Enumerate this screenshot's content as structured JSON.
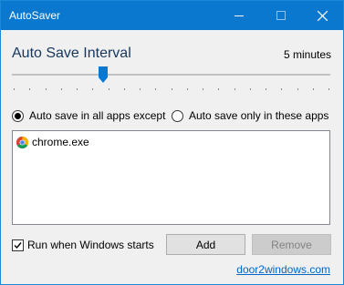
{
  "window": {
    "title": "AutoSaver",
    "controls": {
      "minimize": "minimize-icon",
      "maximize": "maximize-icon",
      "close": "close-icon"
    }
  },
  "interval": {
    "title": "Auto Save Interval",
    "value_label": "5 minutes",
    "slider_position_fraction": 0.28,
    "tick_count": 21
  },
  "mode": {
    "options": [
      {
        "label": "Auto save in all apps except",
        "selected": true
      },
      {
        "label": "Auto save only in these apps",
        "selected": false
      }
    ]
  },
  "apps": {
    "items": [
      {
        "label": "chrome.exe",
        "icon": "chrome-icon"
      }
    ]
  },
  "startup": {
    "label": "Run when Windows starts",
    "checked": true
  },
  "buttons": {
    "add": "Add",
    "remove": "Remove",
    "remove_enabled": false
  },
  "footer": {
    "link": "door2windows.com"
  },
  "colors": {
    "titlebar": "#0b78d0",
    "accent": "#0b78d0",
    "heading": "#17375e",
    "link": "#0066cc"
  }
}
